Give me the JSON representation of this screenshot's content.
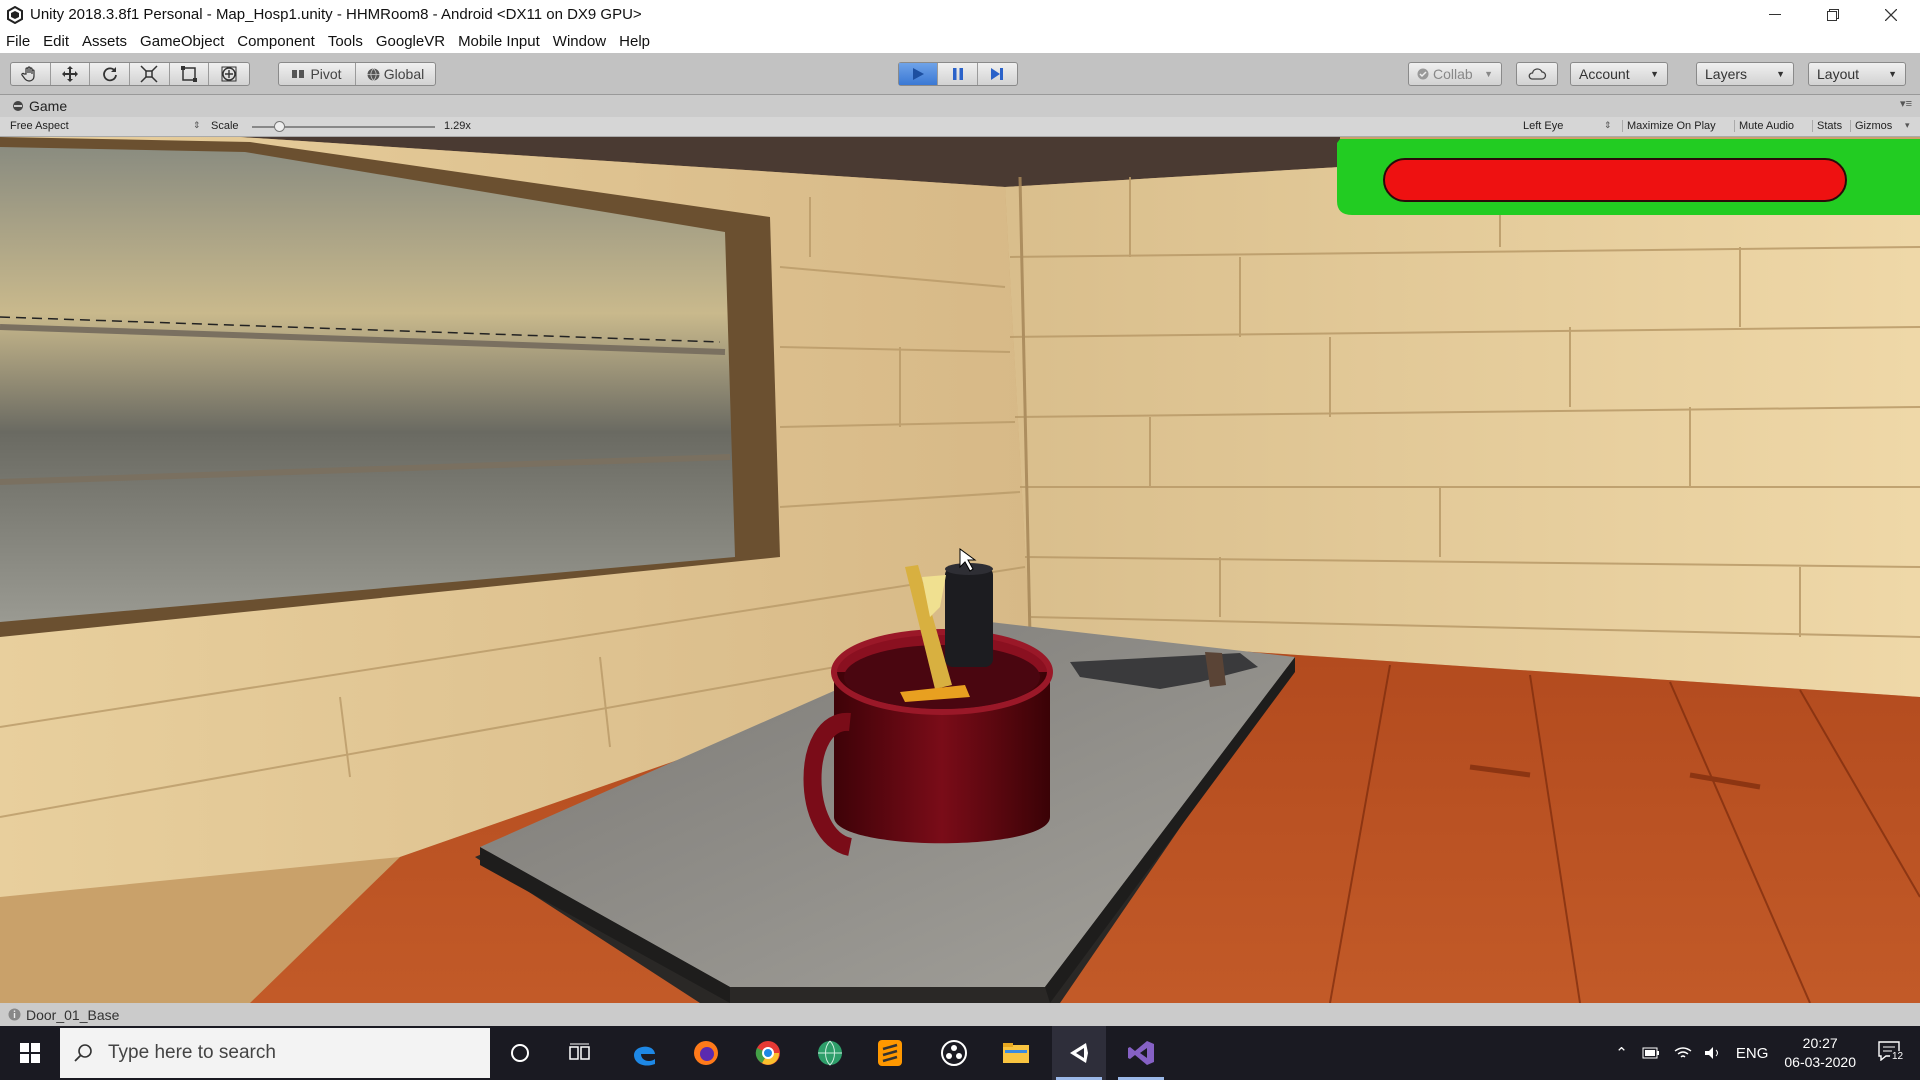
{
  "window": {
    "title": "Unity 2018.3.8f1 Personal - Map_Hosp1.unity - HHMRoom8 - Android <DX11 on DX9 GPU>",
    "controls": [
      "minimize",
      "restore",
      "close"
    ]
  },
  "menu": {
    "items": [
      "File",
      "Edit",
      "Assets",
      "GameObject",
      "Component",
      "Tools",
      "GoogleVR",
      "Mobile Input",
      "Window",
      "Help"
    ]
  },
  "toolbar": {
    "pivot_label": "Pivot",
    "global_label": "Global",
    "collab_label": "Collab",
    "account_label": "Account",
    "layers_label": "Layers",
    "layout_label": "Layout",
    "play_state": "playing"
  },
  "game_view": {
    "tab_label": "Game",
    "aspect": "Free Aspect",
    "scale_label": "Scale",
    "scale_value": "1.29x",
    "scale_fraction": 0.15,
    "eye": "Left Eye",
    "maximize_label": "Maximize On Play",
    "mute_label": "Mute Audio",
    "stats_label": "Stats",
    "gizmos_label": "Gizmos"
  },
  "hud": {
    "health_bar_color": "#ee1111",
    "health_panel_color": "#22cc22"
  },
  "status": {
    "message": "Door_01_Base"
  },
  "taskbar": {
    "search_placeholder": "Type here to search",
    "language": "ENG",
    "time": "20:27",
    "date": "06-03-2020",
    "notification_count": "12"
  },
  "colors": {
    "wall": "#d9bb86",
    "floor": "#a8421c",
    "table": "#8c8a84",
    "mug": "#6a0a14",
    "play_blue": "#3a78d4"
  }
}
